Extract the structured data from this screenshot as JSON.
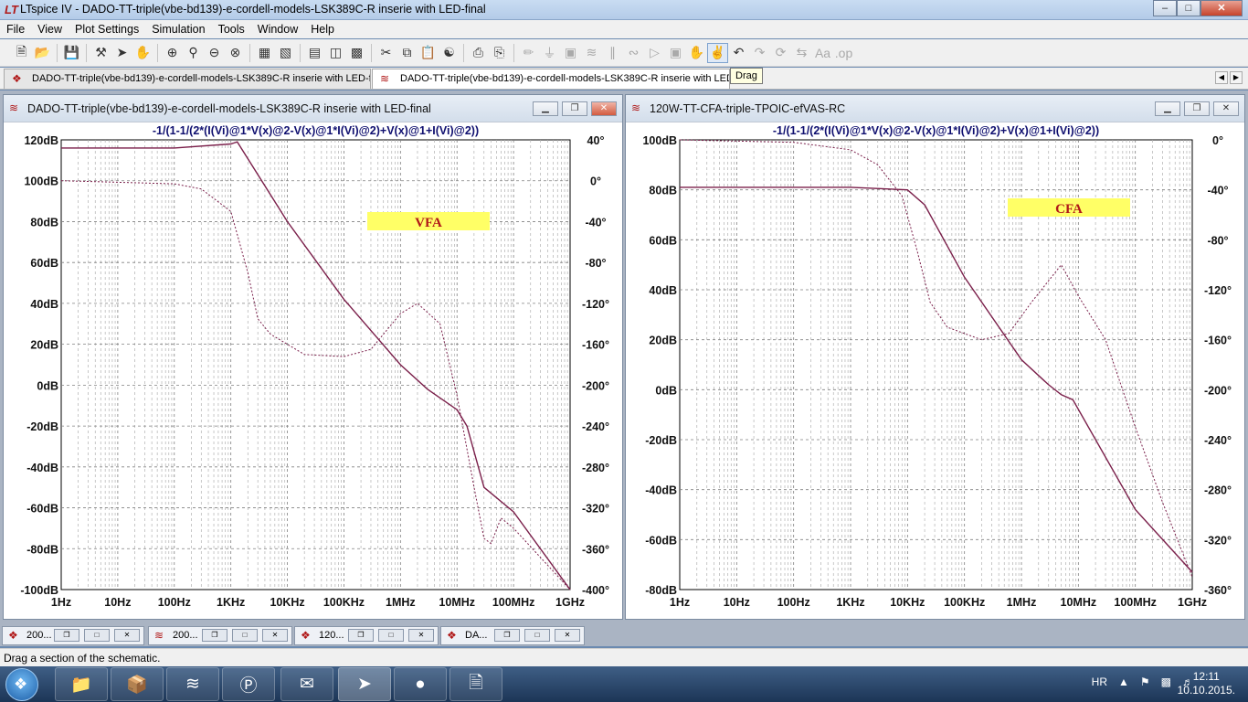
{
  "window": {
    "app_title": "LTspice IV - DADO-TT-triple(vbe-bd139)-e-cordell-models-LSK389C-R inserie with LED-final",
    "minimize": "–",
    "maximize": "□",
    "close": "✕"
  },
  "menu": [
    "File",
    "View",
    "Plot Settings",
    "Simulation",
    "Tools",
    "Window",
    "Help"
  ],
  "toolbar_icons": [
    "new-schematic-icon",
    "open-icon",
    "save-icon",
    "control-panel-icon",
    "run-icon",
    "halt-icon",
    "zoom-in-icon",
    "zoom-pan-icon",
    "zoom-out-icon",
    "zoom-fit-icon",
    "autorange-icon",
    "measure-icon",
    "tile-vertical-icon",
    "cascade-icon",
    "tile-icon",
    "cut-icon",
    "copy-icon",
    "paste-icon",
    "find-icon",
    "print-setup-icon",
    "print-icon",
    "wire-icon",
    "ground-icon",
    "label-icon",
    "resistor-icon",
    "capacitor-icon",
    "inductor-icon",
    "diode-icon",
    "component-icon",
    "move-icon",
    "drag-icon",
    "undo-icon",
    "redo-icon",
    "rotate-icon",
    "mirror-icon",
    "text-icon",
    "spice-directive-icon"
  ],
  "tabs": [
    {
      "label": "DADO-TT-triple(vbe-bd139)-e-cordell-models-LSK389C-R inserie with LED-final",
      "kind": "schematic"
    },
    {
      "label": "DADO-TT-triple(vbe-bd139)-e-cordell-models-LSK389C-R inserie with LED-final",
      "kind": "plot"
    }
  ],
  "tooltip": "Drag",
  "panes": [
    {
      "title": "DADO-TT-triple(vbe-bd139)-e-cordell-models-LSK389C-R inserie with LED-final",
      "trace_expr": "-1/(1-1/(2*(I(Vi)@1*V(x)@2-V(x)@1*I(Vi)@2)+V(x)@1+I(Vi)@2))",
      "annotation": "VFA"
    },
    {
      "title": "120W-TT-CFA-triple-TPOIC-efVAS-RC",
      "trace_expr": "-1/(1-1/(2*(I(Vi)@1*V(x)@2-V(x)@1*I(Vi)@2)+V(x)@1+I(Vi)@2))",
      "annotation": "CFA"
    }
  ],
  "mini_windows": [
    "200...",
    "200...",
    "120...",
    "DA..."
  ],
  "status": "Drag a section of the schematic.",
  "tray": {
    "lang": "HR",
    "time": "12:11",
    "date": "10.10.2015."
  },
  "taskbar_apps": [
    "explorer-icon",
    "package-icon",
    "oscilloscope-icon",
    "ie-icon",
    "outlook-icon",
    "ltspice-icon",
    "media-icon",
    "notepad-icon"
  ],
  "colors": {
    "trace": "#7a1f4a",
    "axis_label": "#101070",
    "grid": "#b0b0b0",
    "annotation_bg": "#ffff66",
    "annotation_fg": "#b01818"
  },
  "chart_data": [
    {
      "type": "line",
      "title": "-1/(1-1/(2*(I(Vi)@1*V(x)@2-V(x)@1*I(Vi)@2)+V(x)@1+I(Vi)@2))",
      "x_scale": "log",
      "x_ticks": [
        "1Hz",
        "10Hz",
        "100Hz",
        "1KHz",
        "10KHz",
        "100KHz",
        "1MHz",
        "10MHz",
        "100MHz",
        "1GHz"
      ],
      "x_range_hz": [
        1,
        1000000000
      ],
      "y_ticks": [
        "120dB",
        "100dB",
        "80dB",
        "60dB",
        "40dB",
        "20dB",
        "0dB",
        "-20dB",
        "-40dB",
        "-60dB",
        "-80dB",
        "-100dB"
      ],
      "ylim": [
        -100,
        120
      ],
      "y2_ticks": [
        "40°",
        "0°",
        "-40°",
        "-80°",
        "-120°",
        "-160°",
        "-200°",
        "-240°",
        "-280°",
        "-320°",
        "-360°",
        "-400°"
      ],
      "y2lim": [
        -400,
        40
      ],
      "grid": true,
      "series": [
        {
          "style": "solid",
          "axis": "left",
          "x": [
            1,
            100,
            1000,
            1300,
            10000,
            100000,
            1000000,
            3000000,
            10000000,
            15000000,
            30000000,
            100000000,
            1000000000
          ],
          "values": [
            116,
            116,
            118,
            119,
            80,
            42,
            10,
            -2,
            -12,
            -20,
            -50,
            -62,
            -100
          ]
        },
        {
          "style": "dashed",
          "axis": "right",
          "x": [
            1,
            100,
            300,
            1000,
            2000,
            3000,
            5000,
            20000,
            100000,
            300000,
            1000000,
            2000000,
            5000000,
            10000000,
            20000000,
            30000000,
            40000000,
            60000000,
            100000000,
            1000000000
          ],
          "values": [
            0,
            -3,
            -8,
            -30,
            -90,
            -135,
            -150,
            -170,
            -172,
            -165,
            -130,
            -120,
            -140,
            -210,
            -300,
            -350,
            -355,
            -330,
            -340,
            -400
          ]
        }
      ]
    },
    {
      "type": "line",
      "title": "-1/(1-1/(2*(I(Vi)@1*V(x)@2-V(x)@1*I(Vi)@2)+V(x)@1+I(Vi)@2))",
      "x_scale": "log",
      "x_ticks": [
        "1Hz",
        "10Hz",
        "100Hz",
        "1KHz",
        "10KHz",
        "100KHz",
        "1MHz",
        "10MHz",
        "100MHz",
        "1GHz"
      ],
      "x_range_hz": [
        1,
        1000000000
      ],
      "y_ticks": [
        "100dB",
        "80dB",
        "60dB",
        "40dB",
        "20dB",
        "0dB",
        "-20dB",
        "-40dB",
        "-60dB",
        "-80dB"
      ],
      "ylim": [
        -80,
        100
      ],
      "y2_ticks": [
        "0°",
        "-40°",
        "-80°",
        "-120°",
        "-160°",
        "-200°",
        "-240°",
        "-280°",
        "-320°",
        "-360°"
      ],
      "y2lim": [
        -360,
        0
      ],
      "grid": true,
      "series": [
        {
          "style": "solid",
          "axis": "left",
          "x": [
            1,
            1000,
            10000,
            20000,
            100000,
            1000000,
            3000000,
            5000000,
            8000000,
            100000000,
            1000000000
          ],
          "values": [
            81,
            81,
            80,
            74,
            45,
            12,
            2,
            -2,
            -4,
            -48,
            -73
          ]
        },
        {
          "style": "dashed",
          "axis": "right",
          "x": [
            1,
            100,
            1000,
            3000,
            8000,
            15000,
            25000,
            50000,
            200000,
            600000,
            1500000,
            5000000,
            10000000,
            30000000,
            100000000,
            300000000,
            1000000000
          ],
          "values": [
            0,
            -2,
            -8,
            -20,
            -45,
            -90,
            -130,
            -150,
            -160,
            -155,
            -130,
            -100,
            -125,
            -160,
            -230,
            -290,
            -350
          ]
        }
      ]
    }
  ]
}
